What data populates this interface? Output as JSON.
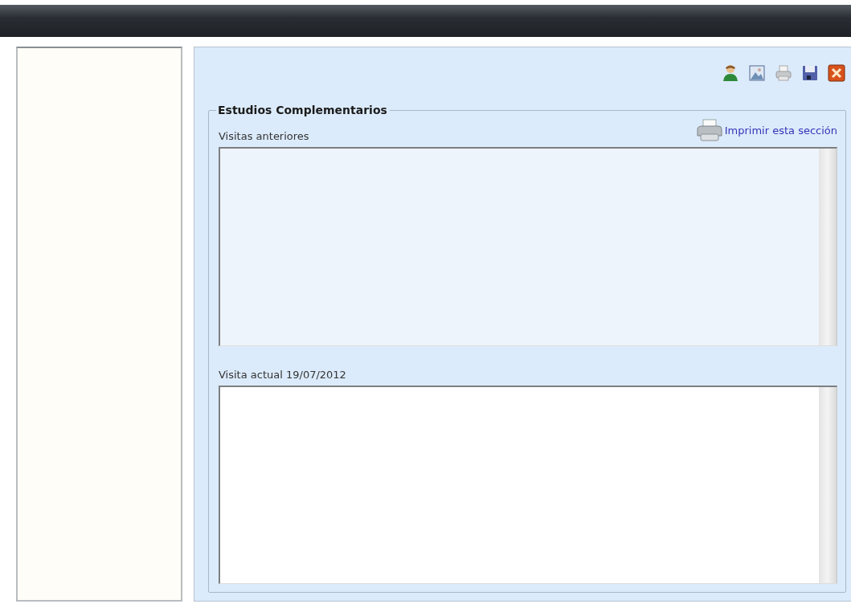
{
  "toolbar": [
    {
      "kind": "user"
    },
    {
      "kind": "picture"
    },
    {
      "kind": "print"
    },
    {
      "kind": "save"
    },
    {
      "kind": "close"
    }
  ],
  "section": {
    "title": "Estudios Complementarios",
    "print_link": "Imprimir esta sección",
    "fields": [
      {
        "label": "Visitas anteriores",
        "disabled": true
      },
      {
        "label": "Visita actual 19/07/2012",
        "disabled": false
      }
    ]
  }
}
